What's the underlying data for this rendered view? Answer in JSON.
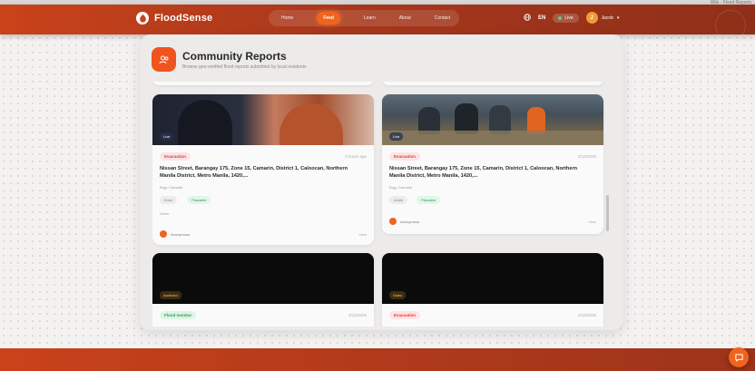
{
  "browser_strip": {
    "text": "Wiki · Flood Reports"
  },
  "brand": {
    "name": "FloodSense",
    "logo_letter": "♨"
  },
  "nav": {
    "items": [
      "Home",
      "Feed",
      "Learn",
      "About",
      "Contact"
    ],
    "active_index": 1
  },
  "right_nav": {
    "language": "EN",
    "live_label": "Live",
    "user_name": "Jacob",
    "user_initial": "J"
  },
  "panel": {
    "title": "Community Reports",
    "subtitle": "Browse geo-verified flood reports submitted by local residents"
  },
  "cards": [
    {
      "image_label": "Live",
      "status": "Evacuation",
      "time": "2 hours ago",
      "title": "Nissan Street, Barangay 175, Zone 15, Camarin, District 1, Caloocan, Northern Manila District, Metro Manila, 1420,...",
      "location": "Brgy. Camarin",
      "tags": [
        "Knee",
        "Passable"
      ],
      "note": "Water",
      "author": "Anonymous",
      "view_label": "View"
    },
    {
      "image_label": "Live",
      "status": "Evacuation",
      "time": "2/12/2025",
      "title": "Nissan Street, Barangay 175, Zone 15, Camarin, District 1, Caloocan, Northern Manila District, Metro Manila, 1420,...",
      "location": "Brgy. Camarin",
      "tags": [
        "Ankle",
        "Passable"
      ],
      "note": "",
      "author": "Anonymous",
      "view_label": "View"
    },
    {
      "image_label": "Archived",
      "status": "Flood monitor",
      "time": "2/12/2025"
    },
    {
      "image_label": "Video",
      "status": "Evacuation",
      "time": "2/12/2025"
    }
  ],
  "colors": {
    "accent": "#f0641e",
    "header_start": "#c9421a",
    "header_end": "#8f2f19",
    "status_red": "#e04040",
    "status_green": "#2f9e5a"
  },
  "icons": {
    "brand": "flame-icon",
    "panel": "users-icon",
    "globe": "globe-icon",
    "chat": "chat-icon"
  }
}
